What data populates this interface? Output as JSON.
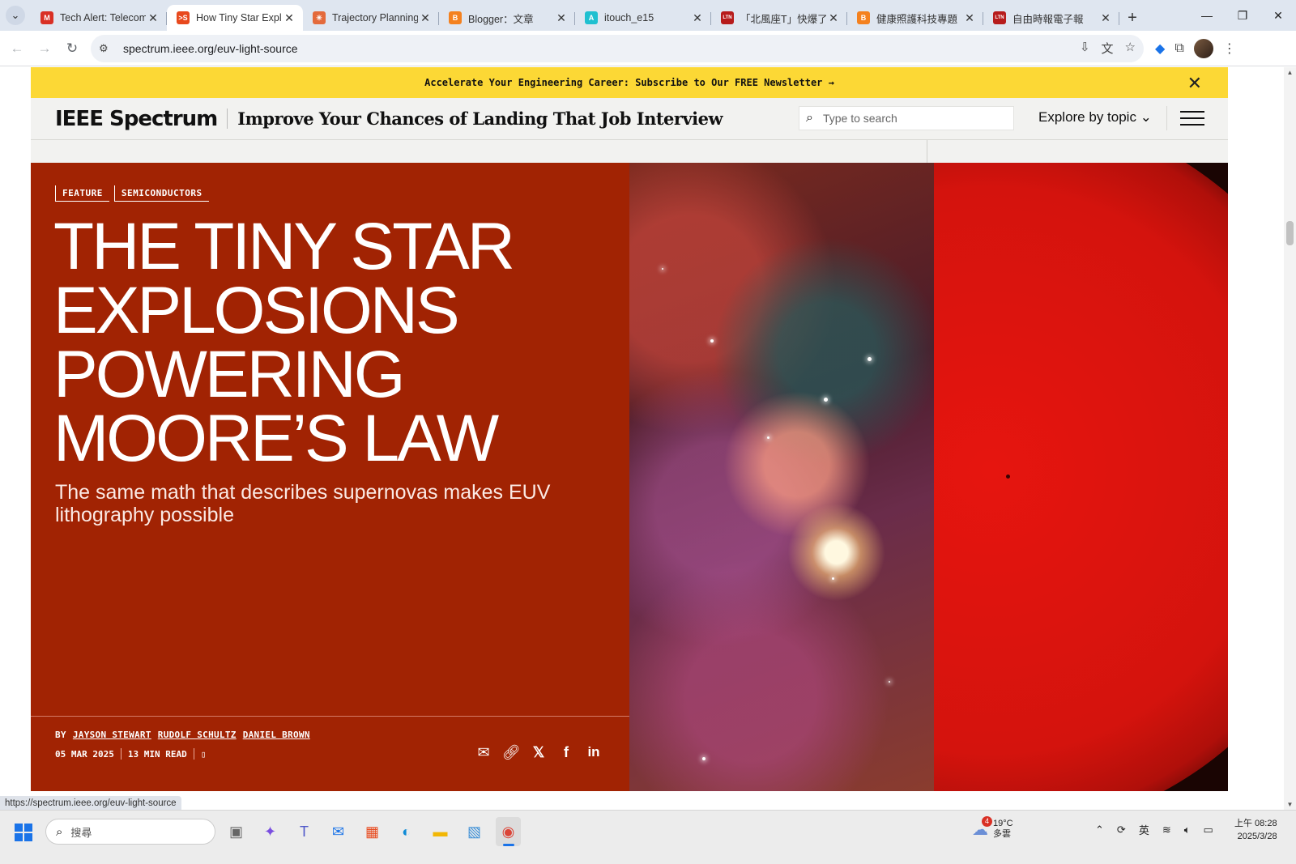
{
  "browser": {
    "tabs": [
      {
        "title": "Tech Alert: Telecom",
        "favicon": "gmail-icon",
        "color": "#d93025",
        "glyph": "M",
        "active": false
      },
      {
        "title": "How Tiny Star Expl",
        "favicon": "spectrum-icon",
        "color": "#e8491d",
        "glyph": ">S",
        "active": true
      },
      {
        "title": "Trajectory Planning",
        "favicon": "sparkle-icon",
        "color": "#e46a3b",
        "glyph": "✳",
        "active": false
      },
      {
        "title": "Blogger：文章",
        "favicon": "blogger-icon",
        "color": "#f4811f",
        "glyph": "B",
        "active": false
      },
      {
        "title": "itouch_e15",
        "favicon": "itouch-icon",
        "color": "#20c0d0",
        "glyph": "A",
        "active": false
      },
      {
        "title": "「北風座T」快爆了",
        "favicon": "ltn-icon",
        "color": "#b71c1c",
        "glyph": "LTN",
        "active": false
      },
      {
        "title": "健康照護科技專題",
        "favicon": "blogger-icon",
        "color": "#f4811f",
        "glyph": "B",
        "active": false
      },
      {
        "title": "自由時報電子報",
        "favicon": "ltn-icon",
        "color": "#b71c1c",
        "glyph": "LTN",
        "active": false
      }
    ],
    "url": "spectrum.ieee.org/euv-light-source",
    "status_url": "https://spectrum.ieee.org/euv-light-source"
  },
  "banner": {
    "text": "Accelerate Your Engineering Career: Subscribe to Our FREE Newsletter →"
  },
  "header": {
    "logo": "IEEE Spectrum",
    "promo_headline": "Improve Your Chances of Landing That Job Interview",
    "search_placeholder": "Type to search",
    "explore_label": "Explore by topic ⌄"
  },
  "article": {
    "tags": [
      "FEATURE",
      "SEMICONDUCTORS"
    ],
    "title": "The Tiny Star Explosions Powering Moore’s Law",
    "dek": "The same math that describes supernovas makes EUV lithography possible",
    "by_label": "BY",
    "authors": [
      "JAYSON STEWART",
      "RUDOLF SCHULTZ",
      "DANIEL BROWN"
    ],
    "date": "05 MAR 2025",
    "read_time": "13 MIN READ",
    "share_icons": [
      "email-icon",
      "link-icon",
      "x-icon",
      "facebook-icon",
      "linkedin-icon"
    ],
    "hero_bg_color": "#a12303"
  },
  "taskbar": {
    "search_placeholder": "搜尋",
    "apps": [
      "file-explorer-icon",
      "copilot-icon",
      "teams-icon",
      "mail-icon",
      "store-icon",
      "edge-icon",
      "folder-icon",
      "photos-icon",
      "chrome-icon"
    ],
    "weather_temp": "19°C",
    "weather_desc": "多雲",
    "weather_badge": "4",
    "ime": "英",
    "time": "上午 08:28",
    "date": "2025/3/28"
  }
}
